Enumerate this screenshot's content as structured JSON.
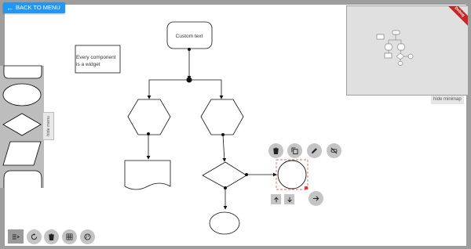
{
  "app": {
    "back_button": "BACK TO MENU",
    "ribbon": "Debug"
  },
  "palette": {
    "toggle_label": "hide menu",
    "shapes": [
      "terminator-shape",
      "ellipse-shape",
      "diamond-shape",
      "parallelogram-shape",
      "tab-shape"
    ]
  },
  "diagram": {
    "start_node": "Custom text",
    "note_line1": "Every component",
    "note_line2": "is a widget"
  },
  "minimap": {
    "toggle_label": "hide minimap"
  },
  "selection_toolbar": {
    "icons": [
      "delete-icon",
      "copy-icon",
      "edit-icon",
      "unlink-icon"
    ],
    "order": [
      "move-up-icon",
      "move-down-icon"
    ],
    "connect": "arrow-right-icon"
  },
  "bottom_toolbar": {
    "icons": [
      "menu-icon",
      "reset-icon",
      "delete-all-icon",
      "grid-icon",
      "palette-icon"
    ]
  },
  "colors": {
    "accent": "#2196f3",
    "selection": "#e53935",
    "ribbon": "#c62828",
    "button": "#c4c4c4"
  }
}
